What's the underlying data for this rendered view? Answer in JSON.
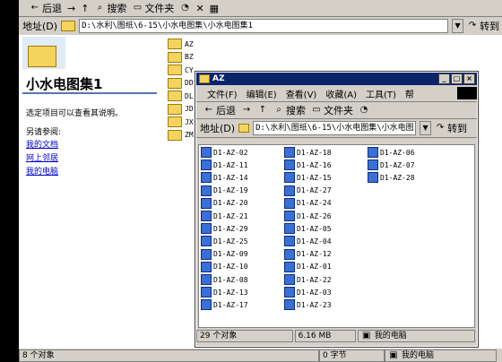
{
  "back_window": {
    "toolbar": {
      "back": "后退",
      "forward": "→",
      "up": "↑",
      "search": "搜索",
      "folders": "文件夹",
      "history": "",
      "close": "✕",
      "views": "▦"
    },
    "address": {
      "label": "地址(D)",
      "value": "D:\\水利\\图纸\\6-15\\小水电图集\\小水电图集1",
      "go": "转到"
    },
    "left_pane": {
      "title": "小水电图集1",
      "hint": "选定项目可以查看其说明。",
      "see_also": "另请参阅:",
      "links": [
        "我的文档",
        "网上邻居",
        "我的电脑"
      ]
    },
    "folders": [
      "AZ",
      "BZ",
      "CY",
      "DD",
      "DL",
      "JD",
      "JX",
      "ZM"
    ],
    "status": {
      "count": "8 个对象",
      "size": "0 字节",
      "location": "我的电脑"
    }
  },
  "front_window": {
    "title": "AZ",
    "menu": [
      "文件(F)",
      "编辑(E)",
      "查看(V)",
      "收藏(A)",
      "工具(T)",
      "帮"
    ],
    "toolbar": {
      "back": "后退",
      "search": "搜索",
      "folders": "文件夹"
    },
    "address": {
      "label": "地址(D)",
      "value": "D:\\水利\\图纸\\6-15\\小水电图集\\小水电图",
      "go": "转到"
    },
    "files_col1": [
      "D1-AZ-02",
      "D1-AZ-11",
      "D1-AZ-14",
      "D1-AZ-19",
      "D1-AZ-20",
      "D1-AZ-21",
      "D1-AZ-29",
      "D1-AZ-25",
      "D1-AZ-09",
      "D1-AZ-10",
      "D1-AZ-08",
      "D1-AZ-13",
      "D1-AZ-17"
    ],
    "files_col2": [
      "D1-AZ-18",
      "D1-AZ-16",
      "D1-AZ-15",
      "D1-AZ-27",
      "D1-AZ-24",
      "D1-AZ-26",
      "D1-AZ-05",
      "D1-AZ-04",
      "D1-AZ-12",
      "D1-AZ-01",
      "D1-AZ-22",
      "D1-AZ-03",
      "D1-AZ-23"
    ],
    "files_col3": [
      "D1-AZ-06",
      "D1-AZ-07",
      "D1-AZ-28"
    ],
    "status": {
      "count": "29 个对象",
      "size": "6.16 MB",
      "location": "我的电脑"
    }
  }
}
